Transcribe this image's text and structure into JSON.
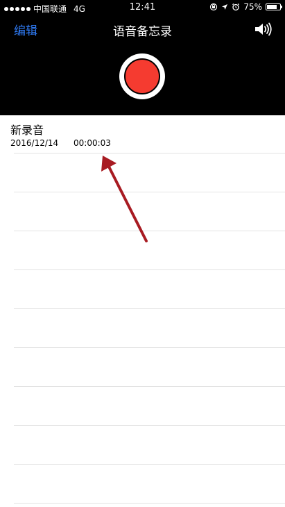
{
  "status_bar": {
    "carrier": "中国联通",
    "network": "4G",
    "time": "12:41",
    "battery_percent": "75%",
    "battery_level": 0.75
  },
  "nav": {
    "edit_label": "编辑",
    "title": "语音备忘录",
    "speaker_icon": "speaker-icon"
  },
  "recordings": [
    {
      "title": "新录音",
      "date": "2016/12/14",
      "duration": "00:00:03"
    }
  ],
  "colors": {
    "accent": "#2f7bf5",
    "record": "#f53b30",
    "annotation_arrow": "#a81b22"
  }
}
